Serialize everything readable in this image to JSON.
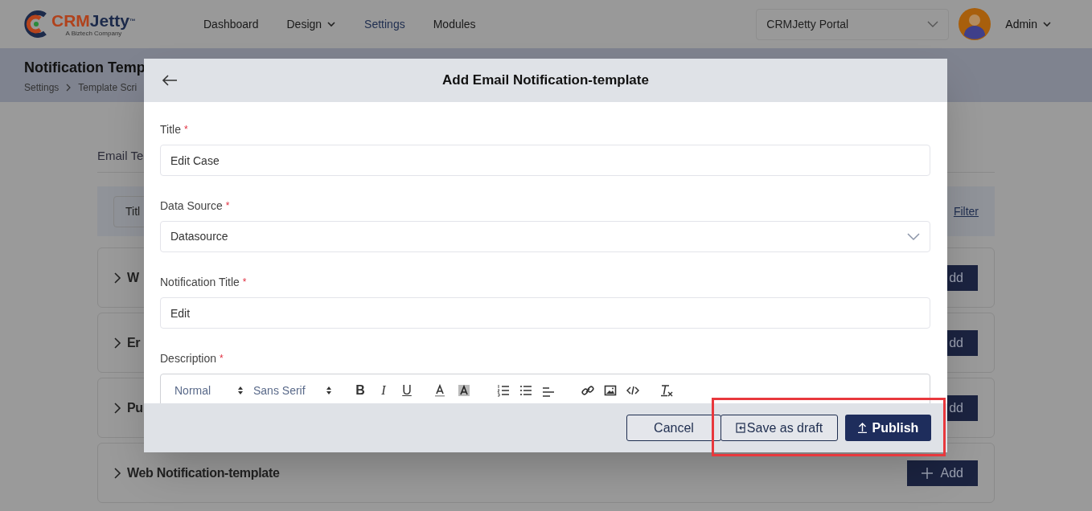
{
  "logo": {
    "text_1": "CRM",
    "text_2": "Jetty",
    "mark": "™",
    "tagline": "A Biztech Company"
  },
  "nav": [
    {
      "label": "Dashboard",
      "selected": false,
      "dropdown": false
    },
    {
      "label": "Design",
      "selected": false,
      "dropdown": true
    },
    {
      "label": "Settings",
      "selected": true,
      "dropdown": false
    },
    {
      "label": "Modules",
      "selected": false,
      "dropdown": false
    }
  ],
  "portal_select": {
    "value": "CRMJetty Portal"
  },
  "user": {
    "name": "Admin"
  },
  "page_header": {
    "title": "Notification Temp",
    "breadcrumb": [
      "Settings",
      "Template Scri"
    ]
  },
  "tab_label": "Email Te",
  "filter": {
    "field_value": "Titl",
    "link": "Filter"
  },
  "sections": [
    {
      "title": "W",
      "button_label": "dd",
      "show_icon": false
    },
    {
      "title": "Er",
      "button_label": "dd",
      "show_icon": false
    },
    {
      "title": "Pu",
      "button_label": "dd",
      "show_icon": false
    },
    {
      "title": "Web Notification-template",
      "button_label": "Add",
      "show_icon": true
    }
  ],
  "modal": {
    "title": "Add Email Notification-template",
    "fields": [
      {
        "kind": "text",
        "label": "Title",
        "required_mark": "*",
        "value": "Edit Case"
      },
      {
        "kind": "select",
        "label": "Data Source",
        "required_mark": "*",
        "value": "Datasource"
      },
      {
        "kind": "text",
        "label": "Notification Title",
        "required_mark": "*",
        "value": "Edit"
      },
      {
        "kind": "editor",
        "label": "Description",
        "required_mark": "*"
      }
    ],
    "toolbar": {
      "selects": [
        "Normal",
        "Sans Serif"
      ],
      "marks": [
        {
          "kind": "bold",
          "glyph": "B"
        },
        {
          "kind": "italic",
          "glyph": "I"
        },
        {
          "kind": "underline",
          "glyph": "U"
        }
      ]
    },
    "buttons": [
      {
        "kind": "cancel",
        "label": "Cancel"
      },
      {
        "kind": "draft",
        "label": "Save as draft"
      },
      {
        "kind": "publish",
        "label": "Publish"
      }
    ],
    "highlight": true
  }
}
